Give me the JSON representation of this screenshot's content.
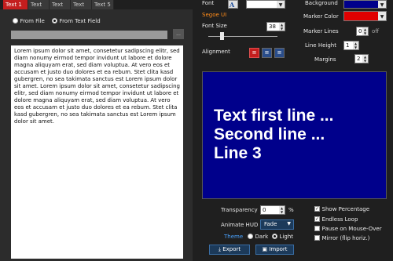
{
  "tabs": [
    {
      "label": "Text 1",
      "active": true
    },
    {
      "label": "Text 2",
      "active": false
    },
    {
      "label": "Text 3",
      "active": false
    },
    {
      "label": "Text 4",
      "active": false
    },
    {
      "label": "Text 5",
      "active": false
    }
  ],
  "source": {
    "from_file": "From File",
    "from_text_field": "From Text Field",
    "selected": "from_text_field",
    "browse_label": "..."
  },
  "text_body": "Lorem ipsum dolor sit amet, consetetur sadipscing elitr, sed diam nonumy eirmod tempor invidunt ut labore et dolore magna aliquyam erat, sed diam voluptua. At vero eos et accusam et justo duo dolores et ea rebum. Stet clita kasd gubergren, no sea takimata sanctus est Lorem ipsum dolor sit amet. Lorem ipsum dolor sit amet, consetetur sadipscing elitr, sed diam nonumy eirmod tempor invidunt ut labore et dolore magna aliquyam erat, sed diam voluptua. At vero eos et accusam et justo duo dolores et ea rebum. Stet clita kasd gubergren, no sea takimata sanctus est Lorem ipsum dolor sit amet.",
  "font": {
    "label": "Font",
    "family_name": "Segoe UI",
    "size_label": "Font Size",
    "size_value": "38",
    "color_swatch": "#ffffff"
  },
  "alignment": {
    "label": "Alignment",
    "options": [
      "left",
      "center",
      "justify"
    ],
    "selected": "left"
  },
  "appearance": {
    "background_label": "Background",
    "background_color": "#00008b",
    "marker_color_label": "Marker Color",
    "marker_color": "#e00000",
    "marker_lines_label": "Marker Lines",
    "marker_lines_value": "0",
    "marker_lines_state": "off",
    "line_height_label": "Line Height",
    "line_height_value": "1",
    "margins_label": "Margins",
    "margins_value": "2"
  },
  "preview": {
    "lines": [
      "Text first line ...",
      "Second line ...",
      "Line 3"
    ]
  },
  "hud": {
    "transparency_label": "Transparency",
    "transparency_value": "0",
    "transparency_unit": "%",
    "animate_label": "Animate HUD",
    "animate_value": "Fade",
    "theme_label": "Theme",
    "theme_dark": "Dark",
    "theme_light": "Light",
    "theme_selected": "light"
  },
  "options": [
    {
      "label": "Show Percentage",
      "checked": true
    },
    {
      "label": "Endless Loop",
      "checked": true
    },
    {
      "label": "Pause on Mouse-Over",
      "checked": false
    },
    {
      "label": "Mirror (flip horiz.)",
      "checked": false
    }
  ],
  "actions": {
    "export_label": "Export",
    "import_label": "Import"
  },
  "colors": {
    "accent_red": "#c41e1e",
    "theme_label_blue": "#4aa3ff",
    "font_name_orange": "#ff8c1a"
  }
}
